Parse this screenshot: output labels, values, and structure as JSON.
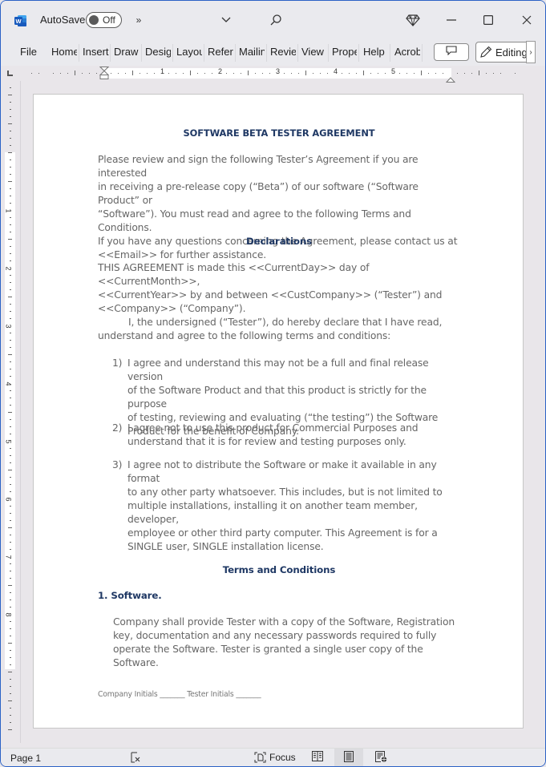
{
  "titlebar": {
    "app_icon": "word-icon",
    "autosave_label": "AutoSave",
    "autosave_state": "Off",
    "more_commands_icon": "double-chevron-right-icon",
    "customize_icon": "chevron-down-icon",
    "search_icon": "search-icon",
    "premium_icon": "diamond-icon",
    "minimize_icon": "minimize-icon",
    "maximize_icon": "maximize-icon",
    "close_icon": "close-icon"
  },
  "ribbon": {
    "tabs": [
      {
        "label": "File"
      },
      {
        "label": "Home"
      },
      {
        "label": "Insert"
      },
      {
        "label": "Draw"
      },
      {
        "label": "Design"
      },
      {
        "label": "Layout"
      },
      {
        "label": "References"
      },
      {
        "label": "Mailings"
      },
      {
        "label": "Review"
      },
      {
        "label": "View"
      },
      {
        "label": "Properties"
      },
      {
        "label": "Help"
      },
      {
        "label": "Acrobat"
      }
    ],
    "comments_icon": "comment-icon",
    "editing_label": "Editing",
    "editing_icon": "pencil-icon",
    "more_icon": "chevron-right-icon"
  },
  "ruler": {
    "horizontal_numbers": [
      "1",
      "2",
      "3",
      "4",
      "5"
    ],
    "vertical_numbers": [
      "1",
      "2",
      "3",
      "4",
      "5",
      "6",
      "7",
      "8"
    ]
  },
  "document": {
    "title": "SOFTWARE BETA TESTER AGREEMENT",
    "intro_lines": [
      "Please review and sign the following Tester’s Agreement if you are interested",
      "in receiving a pre-release copy (“Beta”) of our software (“Software Product” or",
      "“Software”). You must read and agree to the following Terms and Conditions.",
      "If you have any questions concerning the Agreement, please contact us at",
      "<<Email>> for further assistance."
    ],
    "declarations_heading": "Declarations",
    "agreement_lines": [
      "THIS AGREEMENT is made this <<CurrentDay>> day of <<CurrentMonth>>,",
      "<<CurrentYear>> by and between <<CustCompany>> (“Tester”) and",
      "<<Company>> (“Company”)."
    ],
    "undersigned_lines": [
      "I, the undersigned (“Tester”), do hereby declare that I have read,",
      "understand and agree to the following terms and conditions:"
    ],
    "list": [
      {
        "num": "1)",
        "lines": [
          "I agree and understand this may not be a full and final release version",
          "of the Software Product and that this product is strictly for the purpose",
          "of testing, reviewing and evaluating (“the testing”) the Software",
          "Product for the benefit of Company."
        ]
      },
      {
        "num": "2)",
        "lines": [
          "I agree not to use this product for Commercial Purposes and",
          "understand that it is for review and testing purposes only."
        ]
      },
      {
        "num": "3)",
        "lines": [
          "I agree not to distribute the Software or make it available in any format",
          "to any other party whatsoever. This includes, but is not limited to",
          "multiple installations, installing it on another team member, developer,",
          "employee or other third party computer. This Agreement is for a",
          "SINGLE user, SINGLE installation license."
        ]
      }
    ],
    "terms_heading": "Terms and Conditions",
    "section1_heading": "1. Software.",
    "section1_lines": [
      "Company shall provide Tester with a copy of the Software, Registration",
      "key, documentation and any necessary passwords required to fully",
      "operate the Software. Tester is granted a single user copy of the Software."
    ],
    "footer_initials": "Company Initials _______ Tester Initials  _______"
  },
  "statusbar": {
    "page_label": "Page 1",
    "proofing_icon": "proofing-icon",
    "focus_label": "Focus",
    "focus_icon": "focus-icon",
    "read_mode_icon": "read-mode-icon",
    "print_layout_icon": "print-layout-icon",
    "web_layout_icon": "web-layout-icon"
  },
  "colors": {
    "heading": "#1f3864",
    "body_text": "#666666",
    "window_border": "#2b62c6",
    "word_blue": "#185abd"
  }
}
